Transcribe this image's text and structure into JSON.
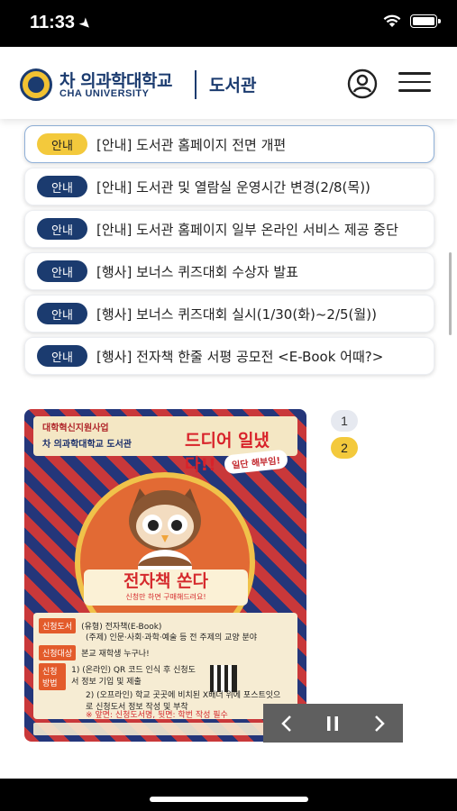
{
  "status_bar": {
    "time": "11:33"
  },
  "header": {
    "logo_ko": "차 의과학대학교",
    "logo_en": "CHA UNIVERSITY",
    "section": "도서관"
  },
  "notices": [
    {
      "badge": "안내",
      "title": "[안내] 도서관 홈페이지 전면 개편",
      "active": true
    },
    {
      "badge": "안내",
      "title": "[안내] 도서관 및 열람실 운영시간 변경(2/8(목))"
    },
    {
      "badge": "안내",
      "title": "[안내] 도서관 홈페이지 일부 온라인 서비스 제공 중단"
    },
    {
      "badge": "안내",
      "title": "[행사] 보너스 퀴즈대회 수상자 발표"
    },
    {
      "badge": "안내",
      "title": "[행사] 보너스 퀴즈대회 실시(1/30(화)~2/5(월))"
    },
    {
      "badge": "안내",
      "title": "[행사] 전자책 한줄 서평 공모전 <E-Book 어때?>"
    }
  ],
  "banner": {
    "program": "대학혁신지원사업",
    "org": "차 의과학대학교 도서관",
    "headline": "드디어 일냈다!!",
    "badge": "일단 해부임!",
    "title": "전자책 쏜다",
    "subtitle": "신청만 하면 구매해드려요!",
    "rows": [
      {
        "tag": "신청도서",
        "text": "(유형) 전자책(E-Book)"
      },
      {
        "tag": "",
        "text": "(주제) 인문·사회·과학·예술 등 전 주제의 교양 분야"
      },
      {
        "tag": "신청대상",
        "text": "본교 재학생 누구나!"
      },
      {
        "tag": "신청방법",
        "text": "1) (온라인) QR 코드 인식 후 신청도서 정보 기입 및 제출"
      },
      {
        "tag": "",
        "text": "2) (오프라인) 학교 곳곳에 비치된 X배너 위에 포스트잇으로 신청도서 정보 작성 및 부착"
      },
      {
        "tag": "",
        "text": "※ 앞면: 신청도서명, 뒷면: 학번 작성 필수"
      }
    ]
  },
  "pager": {
    "pages": [
      "1",
      "2"
    ],
    "current": "2"
  },
  "slider_controls": {
    "prev": "‹",
    "pause": "II",
    "next": "›"
  },
  "colors": {
    "navy": "#1b3b6f",
    "yellow": "#f3c93c"
  }
}
